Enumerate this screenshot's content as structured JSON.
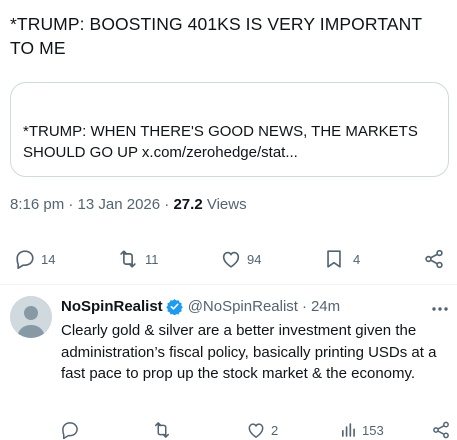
{
  "main_tweet": {
    "text": "*TRUMP: BOOSTING 401KS IS VERY IMPORTANT TO ME",
    "quote": {
      "text": "*TRUMP: WHEN THERE'S GOOD NEWS, THE MARKETS SHOULD GO UP",
      "link": "x.com/zerohedge/stat..."
    },
    "time": "8:16 pm",
    "separator": "·",
    "date": "13 Jan 2026",
    "views_count": "27.2",
    "views_label": "Views",
    "actions": {
      "replies": "14",
      "reposts": "11",
      "likes": "94",
      "bookmarks": "4"
    }
  },
  "reply": {
    "name": "NoSpinRealist",
    "handle": "@NoSpinRealist",
    "separator": "·",
    "time": "24m",
    "text": "Clearly gold & silver are a better investment given the administration’s fiscal policy, basically printing USDs at a fast pace to prop up the stock market & the economy.",
    "actions": {
      "likes": "2",
      "views": "153"
    }
  },
  "colors": {
    "text": "#0f1419",
    "muted": "#536471",
    "border": "#cfd9de",
    "verified": "#1d9bf0"
  },
  "icons": [
    "reply-icon",
    "repost-icon",
    "like-icon",
    "bookmark-icon",
    "share-icon",
    "verified-badge-icon",
    "more-icon",
    "views-icon",
    "avatar-icon"
  ]
}
